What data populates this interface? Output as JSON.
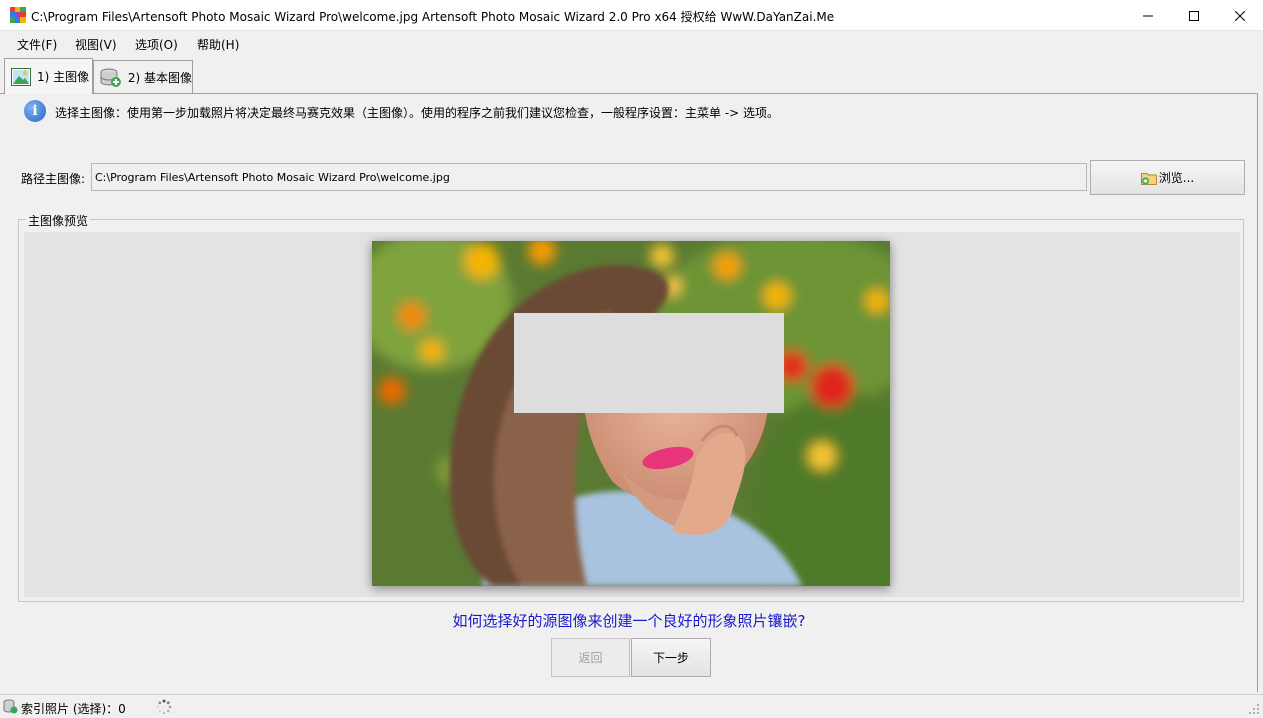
{
  "window": {
    "title": "C:\\Program Files\\Artensoft Photo Mosaic Wizard Pro\\welcome.jpg Artensoft Photo Mosaic Wizard 2.0 Pro x64  授权给 WwW.DaYanZai.Me",
    "icon": "mosaic-app-icon",
    "controls": [
      "minimize-icon",
      "maximize-icon",
      "close-icon"
    ]
  },
  "menu": {
    "file": "文件(F)",
    "view": "视图(V)",
    "options": "选项(O)",
    "help": "帮助(H)"
  },
  "tabs": [
    {
      "label": "1) 主图像",
      "icon": "image-icon",
      "active": true
    },
    {
      "label": "2) 基本图像",
      "icon": "database-add-icon",
      "active": false
    }
  ],
  "info": {
    "icon": "info-icon",
    "text": "选择主图像：使用第一步加载照片将决定最终马赛克效果（主图像）。使用的程序之前我们建议您检查，一般程序设置：主菜单 -> 选项。"
  },
  "path": {
    "label": "路径主图像:",
    "value": "C:\\Program Files\\Artensoft Photo Mosaic Wizard Pro\\welcome.jpg",
    "browse_label": "浏览...",
    "browse_icon": "folder-add-icon"
  },
  "preview": {
    "legend": "主图像预览"
  },
  "help_link": "如何选择好的源图像来创建一个良好的形象照片镶嵌?",
  "nav": {
    "back_label": "返回",
    "next_label": "下一步"
  },
  "status": {
    "text": "索引照片 (选择)：0",
    "icon": "database-status-icon",
    "spinner": "loading-spinner-icon"
  },
  "colors": {
    "link": "#1a1acd",
    "background": "#f0f0f0"
  }
}
